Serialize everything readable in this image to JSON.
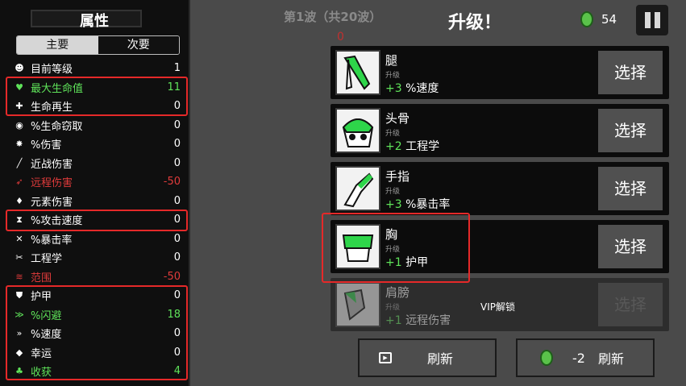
{
  "stats_panel": {
    "title": "属性",
    "tabs": [
      "主要",
      "次要"
    ],
    "stats": [
      {
        "icon": "level-icon",
        "glyph": "☻",
        "label": "目前等级",
        "value": "1",
        "color": "white"
      },
      {
        "icon": "heart-icon",
        "glyph": "♥",
        "label": "最大生命值",
        "value": "11",
        "color": "green"
      },
      {
        "icon": "regen-icon",
        "glyph": "✚",
        "label": "生命再生",
        "value": "0",
        "color": "white"
      },
      {
        "icon": "lifesteal-icon",
        "glyph": "◉",
        "label": "%生命窃取",
        "value": "0",
        "color": "white"
      },
      {
        "icon": "damage-icon",
        "glyph": "✸",
        "label": "%伤害",
        "value": "0",
        "color": "white"
      },
      {
        "icon": "melee-icon",
        "glyph": "╱",
        "label": "近战伤害",
        "value": "0",
        "color": "white"
      },
      {
        "icon": "ranged-icon",
        "glyph": "➶",
        "label": "远程伤害",
        "value": "-50",
        "color": "red"
      },
      {
        "icon": "elemental-icon",
        "glyph": "♦",
        "label": "元素伤害",
        "value": "0",
        "color": "white"
      },
      {
        "icon": "attack-speed-icon",
        "glyph": "⧗",
        "label": "%攻击速度",
        "value": "0",
        "color": "white"
      },
      {
        "icon": "crit-icon",
        "glyph": "✕",
        "label": "%暴击率",
        "value": "0",
        "color": "white"
      },
      {
        "icon": "engineering-icon",
        "glyph": "✂",
        "label": "工程学",
        "value": "0",
        "color": "white"
      },
      {
        "icon": "range-icon",
        "glyph": "≋",
        "label": "范围",
        "value": "-50",
        "color": "red"
      },
      {
        "icon": "armor-icon",
        "glyph": "⛊",
        "label": "护甲",
        "value": "0",
        "color": "white"
      },
      {
        "icon": "dodge-icon",
        "glyph": "≫",
        "label": "%闪避",
        "value": "18",
        "color": "green"
      },
      {
        "icon": "speed-icon",
        "glyph": "»",
        "label": "%速度",
        "value": "0",
        "color": "white"
      },
      {
        "icon": "luck-icon",
        "glyph": "◆",
        "label": "幸运",
        "value": "0",
        "color": "white"
      },
      {
        "icon": "harvest-icon",
        "glyph": "♣",
        "label": "收获",
        "value": "4",
        "color": "green"
      }
    ]
  },
  "header": {
    "wave": "第1波（共20波）",
    "title": "升级！",
    "coins": "54",
    "zero_marker": "0"
  },
  "upgrades": [
    {
      "icon": "leg-icon",
      "name": "腿",
      "sub": "升级",
      "amount": "+3",
      "effect": "%速度",
      "button": "选择",
      "locked": false
    },
    {
      "icon": "skull-icon",
      "name": "头骨",
      "sub": "升级",
      "amount": "+2",
      "effect": "工程学",
      "button": "选择",
      "locked": false
    },
    {
      "icon": "finger-icon",
      "name": "手指",
      "sub": "升级",
      "amount": "+3",
      "effect": "%暴击率",
      "button": "选择",
      "locked": false
    },
    {
      "icon": "chest-icon",
      "name": "胸",
      "sub": "升级",
      "amount": "+1",
      "effect": "护甲",
      "button": "选择",
      "locked": false
    },
    {
      "icon": "shoulder-icon",
      "name": "肩膀",
      "sub": "升级",
      "amount": "+1",
      "effect": "远程伤害",
      "button": "选择",
      "locked": true
    }
  ],
  "vip_label": "VIP解锁",
  "bottom": {
    "refresh": "刷新",
    "refresh_cost": "-2",
    "refresh_coin_label": "刷新"
  }
}
